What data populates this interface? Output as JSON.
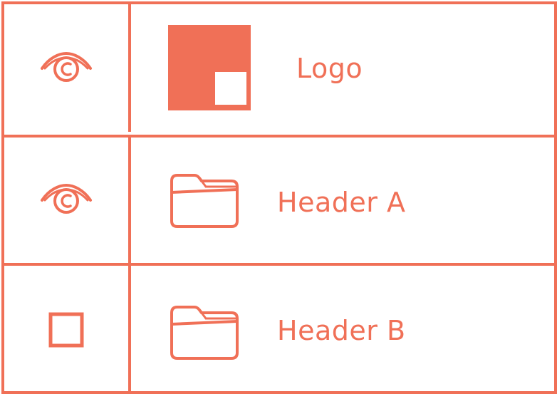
{
  "accent_color": "#F07057",
  "layers": [
    {
      "label": "Logo",
      "visibility": "visible",
      "toggle_icon": "eye-icon",
      "type_icon": "image-layer-icon"
    },
    {
      "label": "Header A",
      "visibility": "visible",
      "toggle_icon": "eye-icon",
      "type_icon": "folder-icon"
    },
    {
      "label": "Header B",
      "visibility": "hidden",
      "toggle_icon": "empty-checkbox-icon",
      "type_icon": "folder-icon"
    }
  ]
}
